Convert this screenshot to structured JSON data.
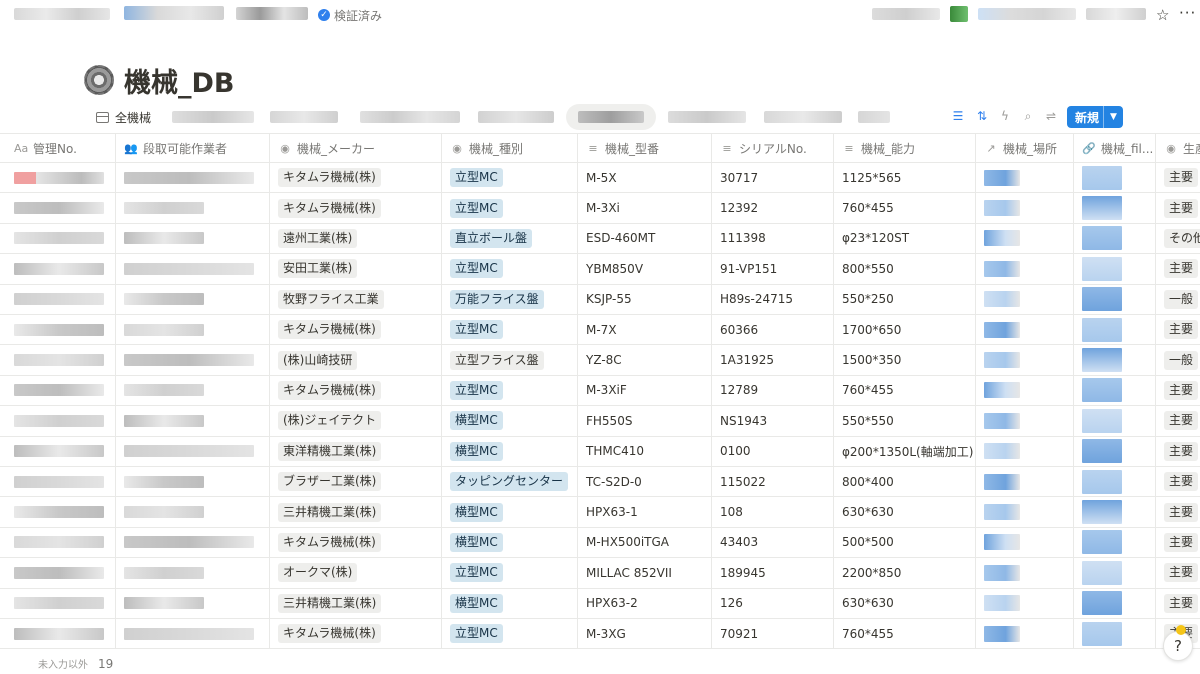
{
  "header": {
    "verified_label": "検証済み",
    "star_icon": "star-icon",
    "more_icon": "more-horizontal-icon"
  },
  "page": {
    "icon": "gear-icon",
    "title": "機械_DB"
  },
  "views": {
    "active_label": "全機械",
    "new_button_label": "新規"
  },
  "columns": [
    {
      "label": "管理No.",
      "icon": "Aa"
    },
    {
      "label": "段取可能作業者",
      "icon": "people-icon"
    },
    {
      "label": "機械_メーカー",
      "icon": "select-icon"
    },
    {
      "label": "機械_種別",
      "icon": "select-icon"
    },
    {
      "label": "機械_型番",
      "icon": "text-icon"
    },
    {
      "label": "シリアルNo.",
      "icon": "text-icon"
    },
    {
      "label": "機械_能力",
      "icon": "text-icon"
    },
    {
      "label": "機械_場所",
      "icon": "relation-icon"
    },
    {
      "label": "機械_fil...",
      "icon": "link-icon"
    },
    {
      "label": "生産",
      "icon": "select-icon"
    }
  ],
  "rows": [
    {
      "maker": "キタムラ機械(株)",
      "type": "立型MC",
      "type_color": "blue",
      "model": "M-5X",
      "serial": "30717",
      "capacity": "1125*565",
      "production": "主要"
    },
    {
      "maker": "キタムラ機械(株)",
      "type": "立型MC",
      "type_color": "blue",
      "model": "M-3Xi",
      "serial": "12392",
      "capacity": "760*455",
      "production": "主要"
    },
    {
      "maker": "遠州工業(株)",
      "type": "直立ボール盤",
      "type_color": "blue",
      "model": "ESD-460MT",
      "serial": "111398",
      "capacity": "φ23*120ST",
      "production": "その他"
    },
    {
      "maker": "安田工業(株)",
      "type": "立型MC",
      "type_color": "blue",
      "model": "YBM850V",
      "serial": "91-VP151",
      "capacity": "800*550",
      "production": "主要"
    },
    {
      "maker": "牧野フライス工業",
      "type": "万能フライス盤",
      "type_color": "blue",
      "model": "KSJP-55",
      "serial": "H89s-24715",
      "capacity": "550*250",
      "production": "一般"
    },
    {
      "maker": "キタムラ機械(株)",
      "type": "立型MC",
      "type_color": "blue",
      "model": "M-7X",
      "serial": "60366",
      "capacity": "1700*650",
      "production": "主要"
    },
    {
      "maker": "(株)山崎技研",
      "type": "立型フライス盤",
      "type_color": "gray",
      "model": "YZ-8C",
      "serial": "1A31925",
      "capacity": "1500*350",
      "production": "一般"
    },
    {
      "maker": "キタムラ機械(株)",
      "type": "立型MC",
      "type_color": "blue",
      "model": "M-3XiF",
      "serial": "12789",
      "capacity": "760*455",
      "production": "主要"
    },
    {
      "maker": "(株)ジェイテクト",
      "type": "横型MC",
      "type_color": "blue",
      "model": "FH550S",
      "serial": "NS1943",
      "capacity": "550*550",
      "production": "主要"
    },
    {
      "maker": "東洋精機工業(株)",
      "type": "横型MC",
      "type_color": "blue",
      "model": "THMC410",
      "serial": "0100",
      "capacity": "φ200*1350L(軸端加工)",
      "production": "主要"
    },
    {
      "maker": "ブラザー工業(株)",
      "type": "タッピングセンター",
      "type_color": "blue",
      "model": "TC-S2D-0",
      "serial": "115022",
      "capacity": "800*400",
      "production": "主要"
    },
    {
      "maker": "三井精機工業(株)",
      "type": "横型MC",
      "type_color": "blue",
      "model": "HPX63-1",
      "serial": "108",
      "capacity": "630*630",
      "production": "主要"
    },
    {
      "maker": "キタムラ機械(株)",
      "type": "横型MC",
      "type_color": "blue",
      "model": "M-HX500iTGA",
      "serial": "43403",
      "capacity": "500*500",
      "production": "主要"
    },
    {
      "maker": "オークマ(株)",
      "type": "立型MC",
      "type_color": "blue",
      "model": "MILLAC 852VII",
      "serial": "189945",
      "capacity": "2200*850",
      "production": "主要"
    },
    {
      "maker": "三井精機工業(株)",
      "type": "横型MC",
      "type_color": "blue",
      "model": "HPX63-2",
      "serial": "126",
      "capacity": "630*630",
      "production": "主要"
    },
    {
      "maker": "キタムラ機械(株)",
      "type": "立型MC",
      "type_color": "blue",
      "model": "M-3XG",
      "serial": "70921",
      "capacity": "760*455",
      "production": "主要"
    }
  ],
  "footer": {
    "label": "未入力以外",
    "count": "19"
  },
  "colors": {
    "accent": "#2383e2",
    "tag_blue_bg": "#d3e5ef",
    "tag_gray_bg": "#eeeeec"
  }
}
